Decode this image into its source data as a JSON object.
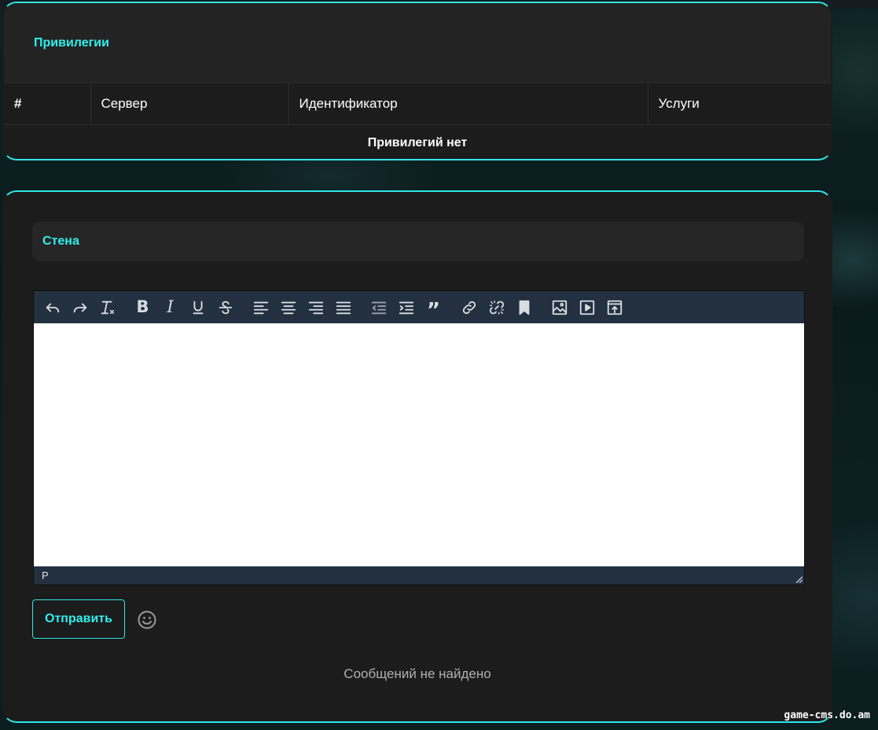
{
  "privileges": {
    "title": "Привилегии",
    "columns": [
      "#",
      "Сервер",
      "Идентификатор",
      "Услуги"
    ],
    "empty_text": "Привилегий нет"
  },
  "wall": {
    "title": "Стена",
    "toolbar_icons": [
      "undo-icon",
      "redo-icon",
      "clear-format-icon",
      "bold-icon",
      "italic-icon",
      "underline-icon",
      "strikethrough-icon",
      "align-left-icon",
      "align-center-icon",
      "align-right-icon",
      "align-justify-icon",
      "outdent-icon",
      "indent-icon",
      "blockquote-icon",
      "link-icon",
      "unlink-icon",
      "bookmark-icon",
      "image-icon",
      "media-icon",
      "upload-icon"
    ],
    "status_path": "P",
    "send_label": "Отправить",
    "empty_text": "Сообщений не найдено"
  },
  "watermark": "game-cms.do.am",
  "colors": {
    "accent": "#2ee6e6",
    "card_bg": "#1c1c1c",
    "editor_toolbar": "#22303f"
  }
}
